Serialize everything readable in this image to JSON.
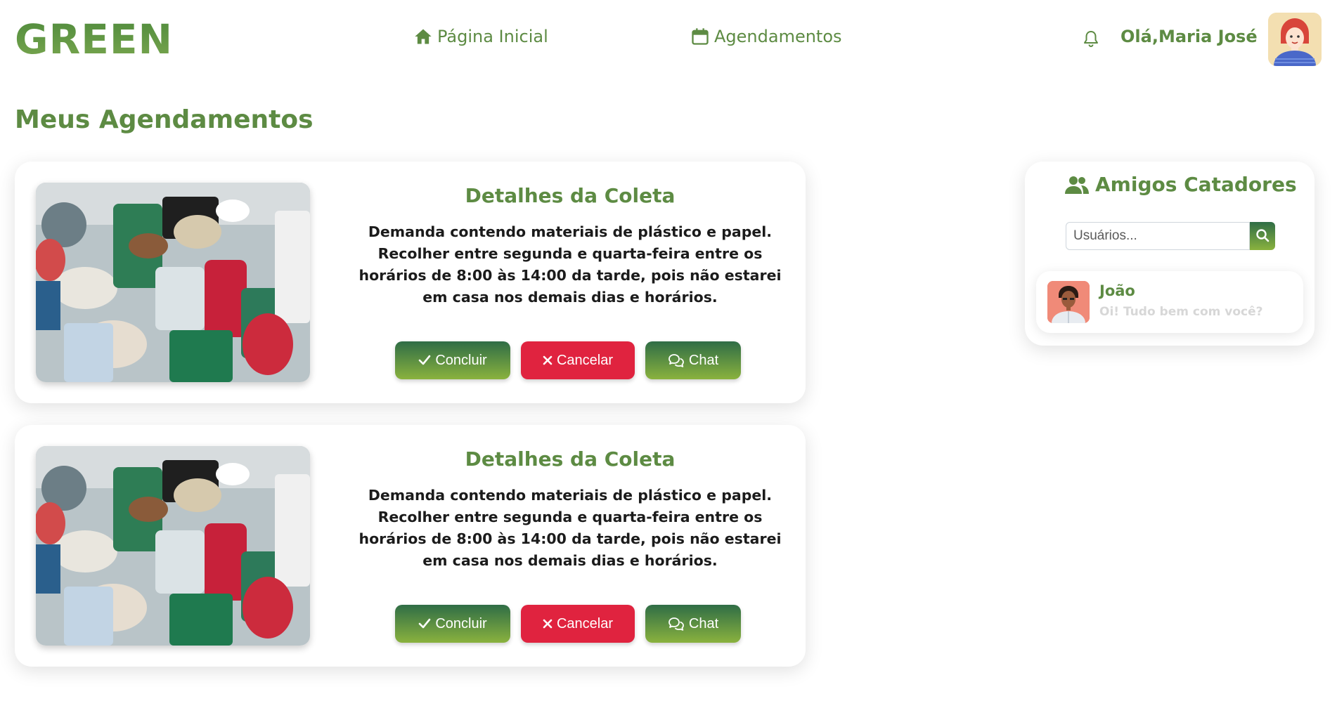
{
  "header": {
    "logo": "GREEN",
    "nav": [
      {
        "label": "Página Inicial",
        "icon": "home-icon"
      },
      {
        "label": "Agendamentos",
        "icon": "calendar-icon"
      }
    ],
    "greeting": "Olá,Maria José"
  },
  "main": {
    "title": "Meus Agendamentos",
    "cards": [
      {
        "title": "Detalhes da Coleta",
        "description": "Demanda contendo materiais de plástico e papel. Recolher entre segunda e quarta-feira entre os horários de 8:00 às 14:00 da tarde, pois não estarei em casa nos demais dias e horários.",
        "buttons": {
          "concluir": "Concluir",
          "cancelar": "Cancelar",
          "chat": "Chat"
        }
      },
      {
        "title": "Detalhes da Coleta",
        "description": "Demanda contendo materiais de plástico e papel. Recolher entre segunda e quarta-feira entre os horários de 8:00 às 14:00 da tarde, pois não estarei em casa nos demais dias e horários.",
        "buttons": {
          "concluir": "Concluir",
          "cancelar": "Cancelar",
          "chat": "Chat"
        }
      }
    ]
  },
  "friends": {
    "title": "Amigos Catadores",
    "search": {
      "placeholder": "Usuários...",
      "value": ""
    },
    "items": [
      {
        "name": "João",
        "message": "Oi! Tudo bem com você?"
      }
    ]
  },
  "colors": {
    "brand_green": "#5d8b43",
    "gradient_dark": "#2f6d46",
    "gradient_light": "#8ab23e",
    "danger": "#e0233f",
    "muted": "#d7d7d7"
  }
}
